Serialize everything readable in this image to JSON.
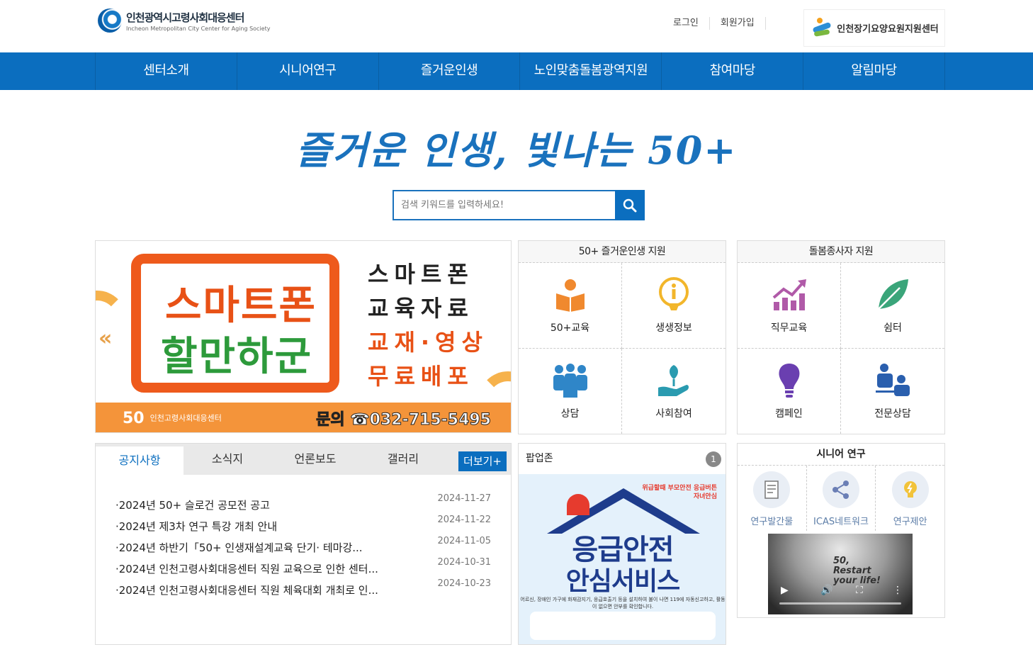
{
  "header": {
    "logo_ko": "인천광역시고령사회대응센터",
    "logo_en": "Incheon Metropolitan City Center for Aging Society",
    "login": "로그인",
    "signup": "회원가입",
    "partner_name": "인천장기요양요원지원센터"
  },
  "nav": {
    "items": [
      "센터소개",
      "시니어연구",
      "즐거운인생",
      "노인맞춤돌봄광역지원",
      "참여마당",
      "알림마당"
    ]
  },
  "hero": {
    "slogan": "즐거운 인생, 빛나는 50+",
    "search_placeholder": "검색 키워드를 입력하세요!"
  },
  "banner": {
    "title1": "스마트폰",
    "title2": "할만하군",
    "right1": "스마트폰",
    "right2": "교육자료",
    "right3": "교재·영상",
    "right4": "무료배포",
    "org": "인천고령사회대응센터",
    "contact": "문의 ☎032-715-5495",
    "prev_icon": "double-chevron-left-icon"
  },
  "support50": {
    "title": "50+ 즐거운인생 지원",
    "items": [
      {
        "label": "50+교육",
        "icon": "reading-icon",
        "color": "#f0892e"
      },
      {
        "label": "생생정보",
        "icon": "info-bulb-icon",
        "color": "#f2b62b"
      },
      {
        "label": "상담",
        "icon": "people-group-icon",
        "color": "#2f86c8"
      },
      {
        "label": "사회참여",
        "icon": "hand-plant-icon",
        "color": "#2a9bb0"
      }
    ]
  },
  "caregiver": {
    "title": "돌봄종사자 지원",
    "items": [
      {
        "label": "직무교육",
        "icon": "growth-chart-icon",
        "color": "#b05aa8"
      },
      {
        "label": "쉼터",
        "icon": "leaf-icon",
        "color": "#3aa57a"
      },
      {
        "label": "캠페인",
        "icon": "lightbulb-icon",
        "color": "#6a3fb0"
      },
      {
        "label": "전문상담",
        "icon": "consultation-icon",
        "color": "#2a5fae"
      }
    ]
  },
  "board": {
    "tabs": [
      "공지사항",
      "소식지",
      "언론보도",
      "갤러리"
    ],
    "more": "더보기+",
    "notices": [
      {
        "title": "·2024년 50+ 슬로건 공모전 공고",
        "date": "2024-11-27"
      },
      {
        "title": "·2024년 제3차 연구 특강 개최 안내",
        "date": "2024-11-22"
      },
      {
        "title": "·2024년 하반기「50+ 인생재설계교육 단기· 테마강...",
        "date": "2024-11-05"
      },
      {
        "title": "·2024년 인천고령사회대응센터 직원 교육으로 인한 센터...",
        "date": "2024-10-31"
      },
      {
        "title": "·2024년 인천고령사회대응센터 직원 체육대회 개최로 인...",
        "date": "2024-10-23"
      }
    ]
  },
  "popup": {
    "title": "팝업존",
    "count": "1",
    "headline1": "응급안전",
    "headline2": "안심서비스",
    "tag": "위급할때 부모안전 응급버튼 자녀안심",
    "desc": "어르신, 장애인 가구에 화재감지기, 응급호출기 등을 설치하여 불이 나면 119에 자동신고하고, 활동이 없으면 안부를 확인합니다."
  },
  "research": {
    "title": "시니어 연구",
    "items": [
      {
        "label": "연구발간물",
        "icon": "document-icon"
      },
      {
        "label": "ICAS네트워크",
        "icon": "share-icon"
      },
      {
        "label": "연구제안",
        "icon": "bulb-icon"
      }
    ],
    "video_caption": "50, Restart your life!"
  },
  "colors": {
    "primary": "#0b6ebf",
    "slogan": "#1a72bd",
    "banner_orange": "#ee5a1c",
    "banner_green": "#2d9a3b"
  }
}
